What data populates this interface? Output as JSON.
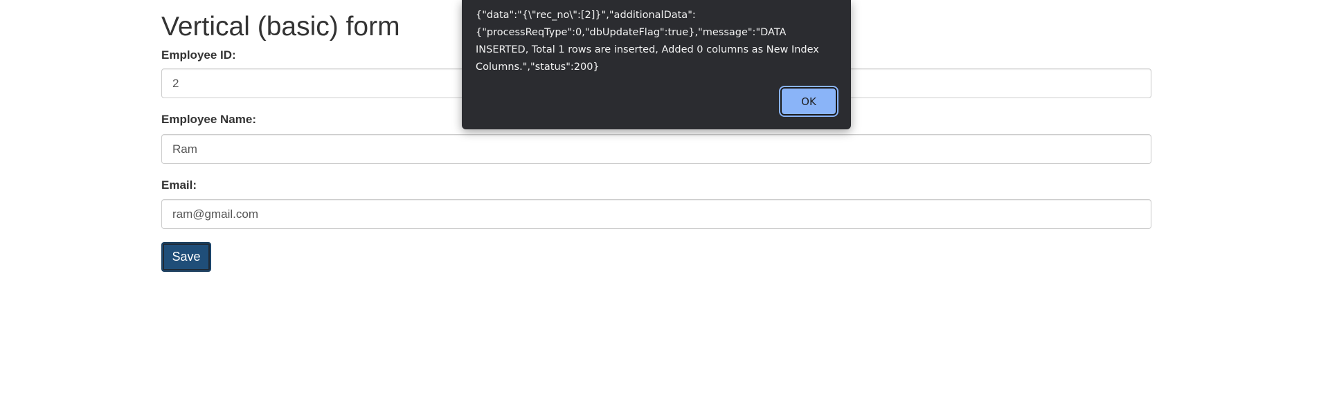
{
  "form": {
    "title": "Vertical (basic) form",
    "fields": [
      {
        "label": "Employee ID:",
        "value": "2"
      },
      {
        "label": "Employee Name:",
        "value": "Ram"
      },
      {
        "label": "Email:",
        "value": "ram@gmail.com"
      }
    ],
    "save_label": "Save"
  },
  "alert": {
    "message": "{\"data\":\"{\\\"rec_no\\\":[2]}\",\"additionalData\":{\"processReqType\":0,\"dbUpdateFlag\":true},\"message\":\"DATA INSERTED, Total 1 rows are inserted, Added 0 columns as New Index Columns.\",\"status\":200}",
    "ok_label": "OK"
  },
  "colors": {
    "primary_button": "#1f4e79",
    "dialog_background": "#2b2c30",
    "dialog_ok_button": "#8ab4f8"
  }
}
